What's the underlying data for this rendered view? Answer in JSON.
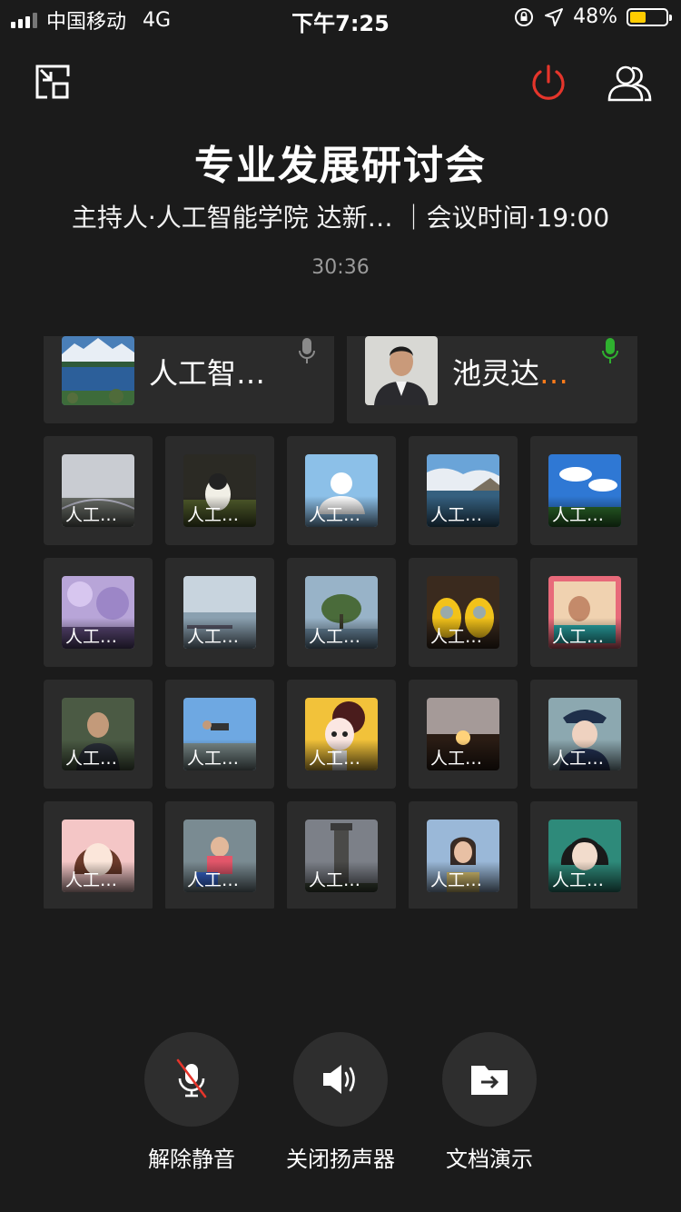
{
  "status_bar": {
    "carrier": "中国移动",
    "network": "4G",
    "time": "下午7:25",
    "battery_percent": "48%",
    "battery_level": 0.44,
    "battery_color": "#ffcc00"
  },
  "header": {
    "title": "专业发展研讨会",
    "subtitle": "主持人·人工智能学院 达新… ｜会议时间·19:00",
    "elapsed": "30:36",
    "power_color": "#e5352b"
  },
  "speakers": [
    {
      "name": "人工智…",
      "dots": "",
      "mic_color": "#8a8a8a"
    },
    {
      "name": "池灵达",
      "dots": "…",
      "mic_color": "#2fb12f"
    }
  ],
  "participants": [
    {
      "label": "人工…"
    },
    {
      "label": "人工…"
    },
    {
      "label": "人工…"
    },
    {
      "label": "人工…"
    },
    {
      "label": "人工…"
    },
    {
      "label": "人工…"
    },
    {
      "label": "人工…"
    },
    {
      "label": "人工…"
    },
    {
      "label": "人工…"
    },
    {
      "label": "人工…"
    },
    {
      "label": "人工…"
    },
    {
      "label": "人工…"
    },
    {
      "label": "人工…"
    },
    {
      "label": "人工…"
    },
    {
      "label": "人工…"
    },
    {
      "label": "人工…"
    },
    {
      "label": "人工…"
    },
    {
      "label": "人工…"
    },
    {
      "label": "人工…"
    },
    {
      "label": "人工…"
    }
  ],
  "controls": {
    "unmute_label": "解除静音",
    "speaker_off_label": "关闭扬声器",
    "doc_present_label": "文档演示"
  },
  "icons": {
    "exit": "exit-fullscreen-icon",
    "power": "power-icon",
    "members": "members-icon",
    "mic": "mic-icon",
    "mic_muted": "mic-muted-icon",
    "speaker": "speaker-icon",
    "document": "document-share-icon"
  }
}
